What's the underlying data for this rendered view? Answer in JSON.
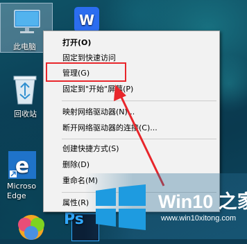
{
  "desktop": {
    "icons": {
      "this_pc": "此电脑",
      "recycle_bin": "回收站",
      "edge_line1": "Microso",
      "edge_line2": "Edge",
      "ps_label": "Ps"
    }
  },
  "context_menu": {
    "items": [
      {
        "label": "打开(O)"
      },
      {
        "label": "固定到快速访问"
      },
      {
        "label": "管理(G)"
      },
      {
        "label": "固定到\"开始\"屏幕(P)"
      },
      {
        "label": "映射网络驱动器(N)..."
      },
      {
        "label": "断开网络驱动器的连接(C)..."
      },
      {
        "label": "创建快捷方式(S)"
      },
      {
        "label": "删除(D)"
      },
      {
        "label": "重命名(M)"
      },
      {
        "label": "属性(R)"
      }
    ]
  },
  "watermark": {
    "title": "Win10 之家",
    "url": "www.win10xitong.com"
  },
  "colors": {
    "highlight": "#e8262b",
    "menu_bg": "#f2f2f2",
    "watermark_blue": "#1e9be0"
  }
}
